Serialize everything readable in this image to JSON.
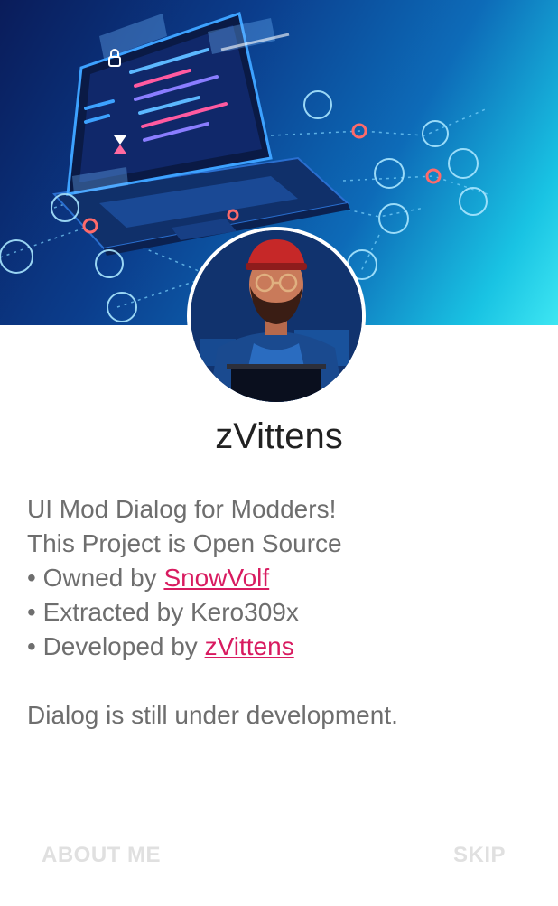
{
  "profile": {
    "name": "zVittens"
  },
  "message": {
    "line1": "UI Mod Dialog for Modders!",
    "line2": "This Project is Open Source",
    "owned_prefix": "• Owned by ",
    "owned_link": "SnowVolf",
    "extracted": "• Extracted by Kero309x",
    "developed_prefix": "• Developed by ",
    "developed_link": "zVittens",
    "footer_note": "Dialog is still under development."
  },
  "buttons": {
    "about": "ABOUT ME",
    "skip": "SKIP"
  },
  "colors": {
    "link": "#d81b60",
    "body_text": "#6e6e6e",
    "title": "#212121",
    "button_disabled": "#e0e0e0"
  },
  "icons": [
    "laptop-illustration",
    "padlock-icon",
    "hourglass-icon",
    "network-node-icons",
    "developer-avatar"
  ]
}
